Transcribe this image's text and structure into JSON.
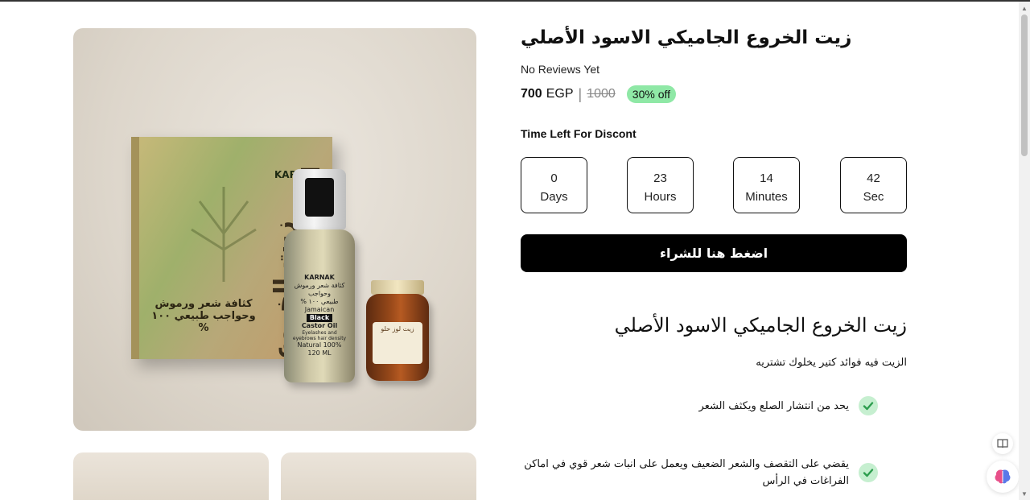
{
  "product": {
    "title": "زيت الخروع الجاميكي الاسود الأصلي",
    "reviews_text": "No Reviews Yet",
    "price": "700",
    "currency": "EGP",
    "separator": "|",
    "old_price": "1000",
    "discount_badge": "30% off"
  },
  "countdown": {
    "title": "Time Left For Discont",
    "units": [
      {
        "value": "0",
        "label": "Days"
      },
      {
        "value": "23",
        "label": "Hours"
      },
      {
        "value": "14",
        "label": "Minutes"
      },
      {
        "value": "42",
        "label": "Sec"
      }
    ]
  },
  "buy_button": "اضغط هنا للشراء",
  "description": {
    "heading": "زيت الخروع الجاميكي الاسود الأصلي",
    "intro": "الزيت فيه فوائد كتير يخلوك تشتريه",
    "features": [
      "يحد من انتشار الصلع ويكثف الشعر",
      "يقضي على التقصف والشعر الضعيف ويعمل على انبات شعر قوي في اماكن الفراغات في الرأس"
    ]
  },
  "image_text": {
    "box_title": "زيت الخروع الاسود الجاميكي",
    "box_brand": "KARNAK",
    "box_sub": "كثافة شعر ورموش وحواجب طبيعي ١٠٠ %",
    "bottle_brand": "KARNAK",
    "bottle_line1": "كثافة شعر ورموش وحواجب",
    "bottle_line2": "طبيعي ١٠٠ %",
    "bottle_line3": "Jamaican",
    "bottle_black": "Black",
    "bottle_line4": "Castor Oil",
    "bottle_line5": "Eyelashes and eyebrows hair density",
    "bottle_line6": "Natural 100%",
    "bottle_line7": "120 ML",
    "jar_label": "زيت لوز حلو"
  },
  "colors": {
    "badge_bg": "#8fe8a6",
    "check_bg": "#c6efd0",
    "check_color": "#2e9e4f",
    "button_bg": "#000000"
  },
  "icons": [
    "check-icon",
    "reader-icon",
    "brain-icon",
    "leaf-icon"
  ]
}
